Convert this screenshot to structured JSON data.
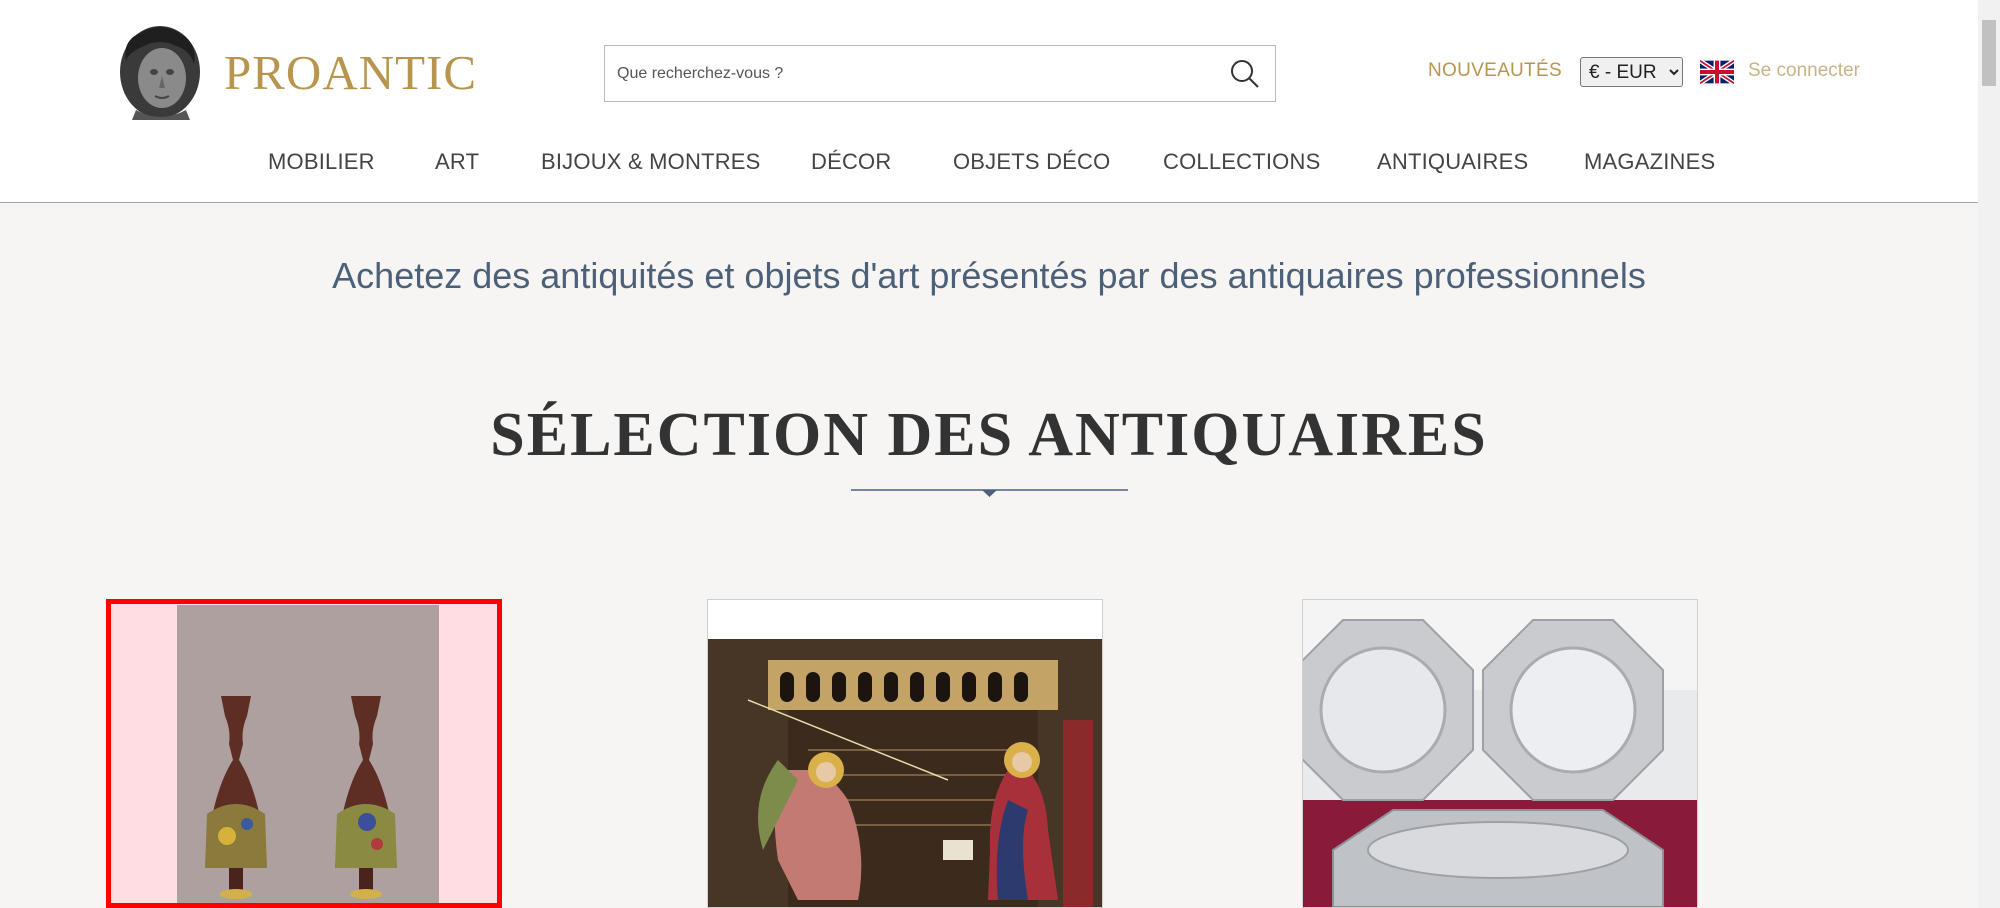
{
  "brand": {
    "name": "PROANTIC"
  },
  "search": {
    "placeholder": "Que recherchez-vous ?"
  },
  "header": {
    "nouveautes": "NOUVEAUTÉS",
    "currency": {
      "selected": "€ - EUR",
      "options": [
        "€ - EUR"
      ]
    },
    "language_icon": "uk-flag-icon",
    "login": "Se connecter"
  },
  "nav": {
    "items": [
      {
        "label": "MOBILIER"
      },
      {
        "label": "ART"
      },
      {
        "label": "BIJOUX & MONTRES"
      },
      {
        "label": "DÉCOR"
      },
      {
        "label": "OBJETS DÉCO"
      },
      {
        "label": "COLLECTIONS"
      },
      {
        "label": "ANTIQUAIRES"
      },
      {
        "label": "MAGAZINES"
      }
    ]
  },
  "main": {
    "tagline": "Achetez des antiquités et objets d'art présentés par des antiquaires professionnels",
    "section_title": "SÉLECTION DES ANTIQUAIRES"
  },
  "colors": {
    "gold": "#b8954f",
    "nav_text": "#444444",
    "tagline": "#4c6179",
    "highlight": "#ff0000"
  }
}
